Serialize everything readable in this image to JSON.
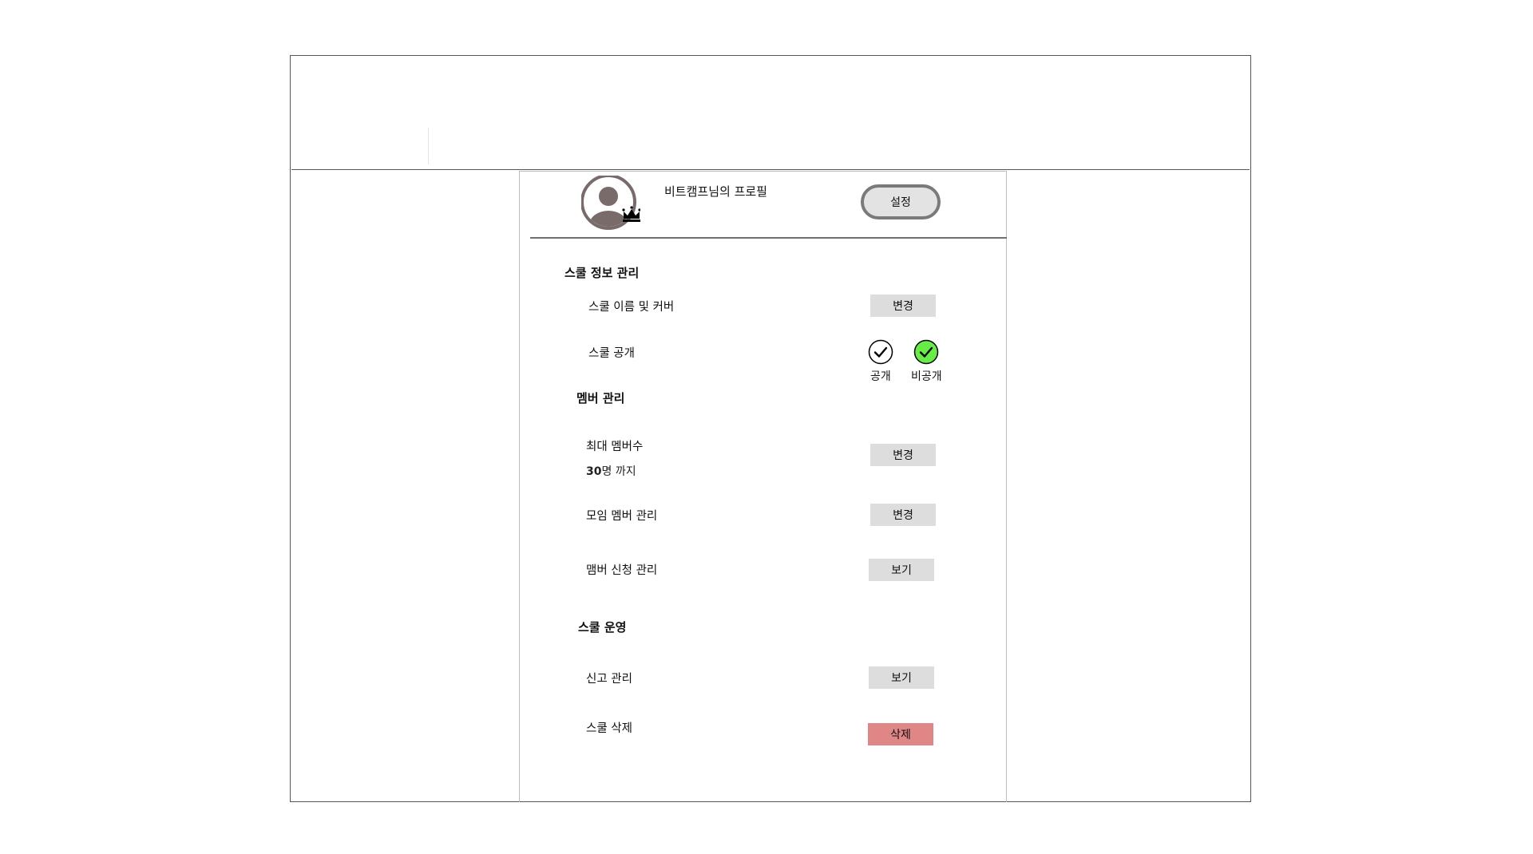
{
  "profile": {
    "title": "비트캠프님의 프로필",
    "settings_label": "설정"
  },
  "sections": {
    "info": {
      "title": "스쿨 정보 관리",
      "name_cover_label": "스쿨 이름 및 커버",
      "name_cover_button": "변경",
      "visibility_label": "스쿨 공개",
      "visibility_options": [
        {
          "label": "공개",
          "selected": false
        },
        {
          "label": "비공개",
          "selected": true
        }
      ]
    },
    "members": {
      "title": "멤버 관리",
      "max_members_label": "최대 멤버수",
      "max_members_value": "30",
      "max_members_unit": "명 까지",
      "max_members_button": "변경",
      "group_members_label": "모임 멤버 관리",
      "group_members_button": "변경",
      "applications_label": "맴버 신청 관리",
      "applications_button": "보기"
    },
    "operation": {
      "title": "스쿨 운영",
      "reports_label": "신고 관리",
      "reports_button": "보기",
      "delete_label": "스쿨 삭제",
      "delete_button": "삭제"
    }
  },
  "icons": {
    "avatar": "user-avatar-icon",
    "badge": "crown-icon",
    "check": "check-icon"
  },
  "colors": {
    "selected_radio": "#66ee44",
    "delete_button": "#e08686",
    "gray_button": "#dddddd"
  }
}
